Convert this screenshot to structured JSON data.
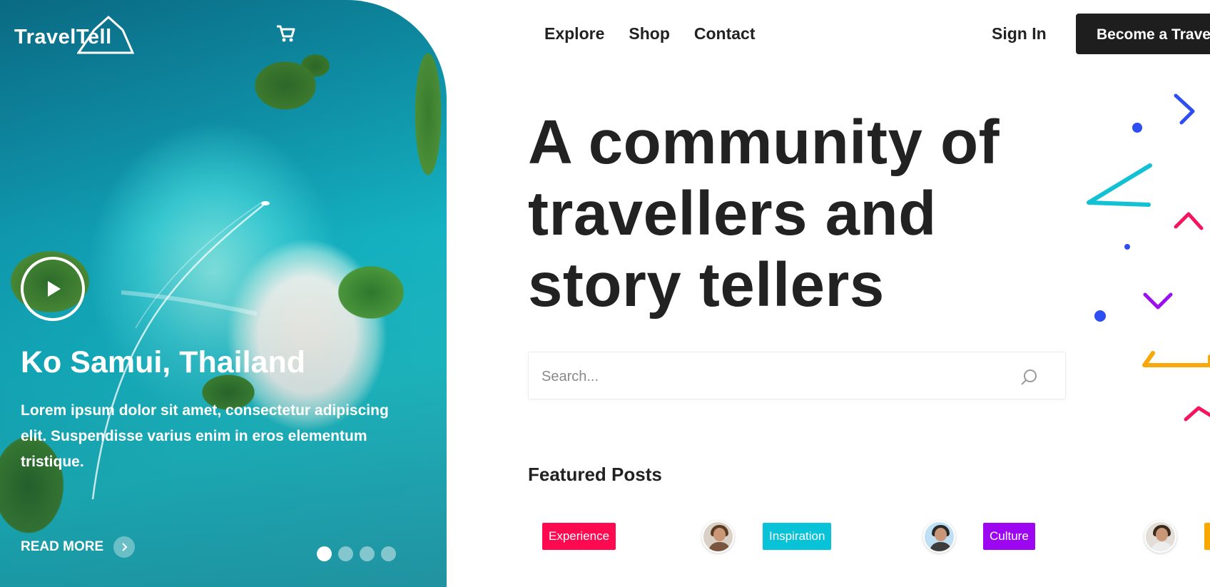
{
  "brand": {
    "logo_text": "TravelTell"
  },
  "hero": {
    "title": "Ko Samui, Thailand",
    "description": "Lorem ipsum dolor sit amet, consectetur adipiscing elit. Suspendisse varius enim in eros elementum tristique.",
    "read_more_label": "READ MORE",
    "slide_count": 4,
    "active_slide": 1
  },
  "nav": {
    "items": [
      {
        "label": "Explore"
      },
      {
        "label": "Shop"
      },
      {
        "label": "Contact"
      }
    ],
    "sign_in_label": "Sign In",
    "cta_label": "Become a Traveller"
  },
  "headline": {
    "line1": "A community of",
    "line2": "travellers and",
    "line3": "story tellers"
  },
  "search": {
    "placeholder": "Search...",
    "value": ""
  },
  "featured": {
    "title": "Featured Posts",
    "tags": [
      {
        "label": "Experience",
        "color": "#ff0a51"
      },
      {
        "label": "Inspiration",
        "color": "#08c2d8"
      },
      {
        "label": "Culture",
        "color": "#9d06f0"
      },
      {
        "label": "",
        "color": "#f9a800"
      }
    ]
  },
  "colors": {
    "text": "#222222",
    "cta_bg": "#1e1e1e",
    "confetti_blue": "#2d4ef0",
    "confetti_cyan": "#12c2d4",
    "confetti_pink": "#f5155f",
    "confetti_purple": "#9b10f0",
    "confetti_orange": "#f7a80a"
  },
  "icons": [
    "logo-triangle-icon",
    "cart-icon",
    "play-icon",
    "chevron-right-icon",
    "search-icon"
  ]
}
